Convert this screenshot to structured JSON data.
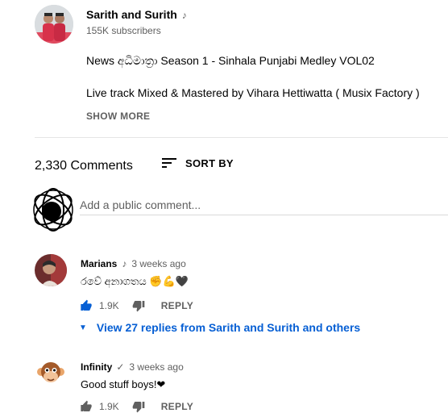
{
  "channel": {
    "name": "Sarith and Surith",
    "subscribers": "155K subscribers"
  },
  "description": {
    "line1": "News අධිමාත්‍රා Season 1 - Sinhala Punjabi Medley VOL02",
    "line2": "Live track Mixed & Mastered by Vihara Hettiwatta ( Musix Factory )",
    "show_more": "SHOW MORE"
  },
  "comments_header": {
    "count": "2,330 Comments",
    "sort_label": "SORT BY"
  },
  "add_comment": {
    "placeholder": "Add a public comment..."
  },
  "comments": [
    {
      "author": "Marians",
      "time": "3 weeks ago",
      "text": "රවේ අනාගතය ✊💪🖤",
      "likes": "1.9K",
      "reply_label": "REPLY",
      "view_replies": "View 27 replies from Sarith and Surith and others"
    },
    {
      "author": "Infinity",
      "time": "3 weeks ago",
      "text": "Good stuff boys!❤",
      "likes": "1.9K",
      "reply_label": "REPLY"
    }
  ],
  "colors": {
    "accent_blue": "#065fd4",
    "secondary_text": "#606060",
    "like_blue": "#065fd4"
  },
  "icons": {
    "music": "music-note-icon",
    "sort": "sort-icon",
    "like": "thumbs-up-icon",
    "dislike": "thumbs-down-icon",
    "expand": "chevron-down-icon",
    "verified": "check-icon"
  }
}
